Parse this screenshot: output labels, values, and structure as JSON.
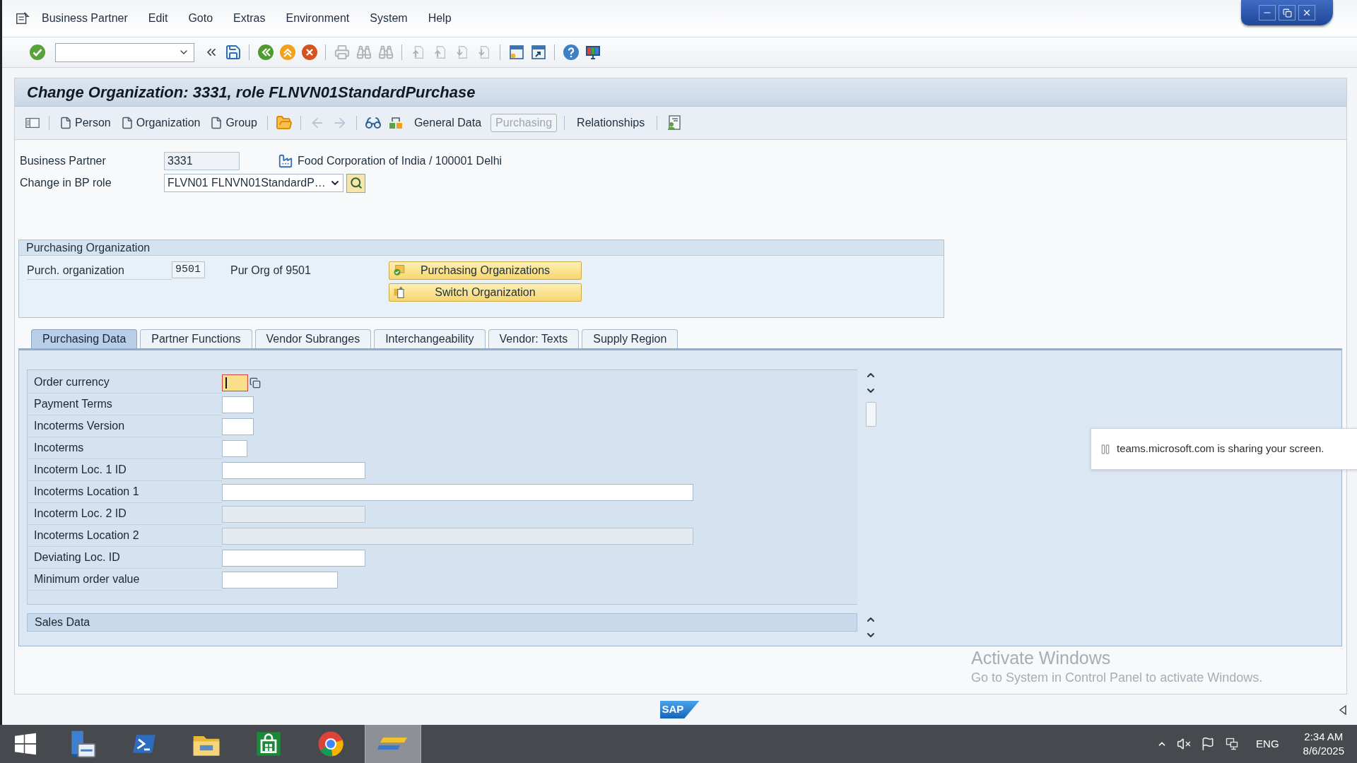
{
  "menu_bar": {
    "items": [
      "Business Partner",
      "Edit",
      "Goto",
      "Extras",
      "Environment",
      "System",
      "Help"
    ]
  },
  "toolbar": {
    "buttons": [
      {
        "kind": "enter",
        "disabled": false
      },
      {
        "kind": "command_field"
      },
      {
        "kind": "collapse",
        "disabled": false
      },
      {
        "kind": "save",
        "disabled": false
      },
      {
        "kind": "separator"
      },
      {
        "kind": "back",
        "disabled": false
      },
      {
        "kind": "exit",
        "disabled": false
      },
      {
        "kind": "cancel",
        "disabled": false
      },
      {
        "kind": "separator"
      },
      {
        "kind": "print",
        "disabled": true
      },
      {
        "kind": "find",
        "disabled": true
      },
      {
        "kind": "find_next",
        "disabled": true
      },
      {
        "kind": "separator"
      },
      {
        "kind": "first_page",
        "disabled": true
      },
      {
        "kind": "previous_page",
        "disabled": true
      },
      {
        "kind": "next_page",
        "disabled": true
      },
      {
        "kind": "last_page",
        "disabled": true
      },
      {
        "kind": "separator"
      },
      {
        "kind": "new_session",
        "disabled": false
      },
      {
        "kind": "shortcut",
        "disabled": false
      },
      {
        "kind": "separator"
      },
      {
        "kind": "help",
        "disabled": false
      },
      {
        "kind": "layout",
        "disabled": false
      }
    ]
  },
  "title": "Change Organization: 3331, role FLNVN01StandardPurchase",
  "app_toolbar": {
    "items": [
      {
        "kind": "locator",
        "disabled": false
      },
      {
        "kind": "separator"
      },
      {
        "kind": "create",
        "label": "Person",
        "disabled": false
      },
      {
        "kind": "create",
        "label": "Organization",
        "disabled": false
      },
      {
        "kind": "create",
        "label": "Group",
        "disabled": false
      },
      {
        "kind": "separator"
      },
      {
        "kind": "open",
        "disabled": false
      },
      {
        "kind": "separator"
      },
      {
        "kind": "back",
        "disabled": true
      },
      {
        "kind": "forward",
        "disabled": true
      },
      {
        "kind": "separator"
      },
      {
        "kind": "display_change",
        "disabled": false
      },
      {
        "kind": "switch",
        "disabled": false
      },
      {
        "kind": "view",
        "label": "General Data",
        "selected": false
      },
      {
        "kind": "view",
        "label": "Purchasing",
        "selected": true
      },
      {
        "kind": "separator"
      },
      {
        "kind": "view",
        "label": "Relationships",
        "selected": false
      },
      {
        "kind": "separator"
      },
      {
        "kind": "where_used",
        "disabled": false
      }
    ]
  },
  "business_partner": {
    "label": "Business Partner",
    "value": "3331",
    "description": "Food Corporation of India / 100001 Delhi"
  },
  "bp_role": {
    "label": "Change in BP role",
    "value": "FLVN01 FLNVN01StandardP…"
  },
  "purchasing_organization": {
    "title": "Purchasing Organization",
    "label": "Purch. organization",
    "value": "9501",
    "description": "Pur Org of 9501",
    "buttons": [
      {
        "kind": "list",
        "label": "Purchasing Organizations"
      },
      {
        "kind": "switch",
        "label": "Switch Organization"
      }
    ]
  },
  "tabs": [
    {
      "label": "Purchasing Data",
      "selected": true
    },
    {
      "label": "Partner Functions",
      "selected": false
    },
    {
      "label": "Vendor Subranges",
      "selected": false
    },
    {
      "label": "Interchangeability",
      "selected": false
    },
    {
      "label": "Vendor: Texts",
      "selected": false
    },
    {
      "label": "Supply Region",
      "selected": false
    }
  ],
  "fields": [
    {
      "label": "Order currency",
      "focused": true,
      "disabled": false
    },
    {
      "label": "Payment Terms",
      "focused": false,
      "disabled": false
    },
    {
      "label": "Incoterms Version",
      "focused": false,
      "disabled": false
    },
    {
      "label": "Incoterms",
      "focused": false,
      "disabled": false
    },
    {
      "label": "Incoterm Loc. 1 ID",
      "focused": false,
      "disabled": false
    },
    {
      "label": "Incoterms Location 1",
      "focused": false,
      "disabled": false
    },
    {
      "label": "Incoterm Loc. 2 ID",
      "focused": false,
      "disabled": true
    },
    {
      "label": "Incoterms Location 2",
      "focused": false,
      "disabled": true
    },
    {
      "label": "Deviating Loc. ID",
      "focused": false,
      "disabled": false
    },
    {
      "label": "Minimum order value",
      "focused": false,
      "disabled": false
    }
  ],
  "sales_data": {
    "title": "Sales Data"
  },
  "screen_share_notice": {
    "text": "teams.microsoft.com is sharing your screen."
  },
  "activation_notice": {
    "title": "Activate Windows",
    "text": "Go to System in Control Panel to activate Windows."
  },
  "footer": {
    "logo": "SAP"
  },
  "taskbar": {
    "apps": [
      {
        "kind": "start",
        "selected": false
      },
      {
        "kind": "server_manager",
        "selected": false
      },
      {
        "kind": "powershell",
        "selected": false
      },
      {
        "kind": "file_explorer",
        "selected": false
      },
      {
        "kind": "store",
        "selected": false
      },
      {
        "kind": "browser",
        "selected": false
      },
      {
        "kind": "sap_logon",
        "selected": true
      }
    ],
    "language": "ENG",
    "time": "2:34 AM",
    "date": "8/6/2025"
  }
}
